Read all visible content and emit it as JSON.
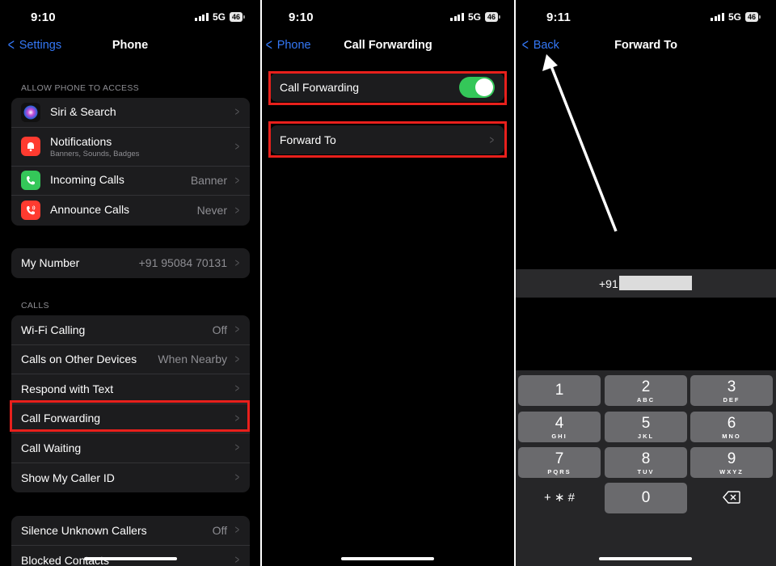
{
  "status": {
    "p1_time": "9:10",
    "p2_time": "9:10",
    "p3_time": "9:11",
    "network": "5G",
    "battery": "46"
  },
  "p1": {
    "back_label": "Settings",
    "title": "Phone",
    "section_access": "ALLOW PHONE TO ACCESS",
    "siri": "Siri & Search",
    "notifications": "Notifications",
    "notifications_sub": "Banners, Sounds, Badges",
    "incoming": "Incoming Calls",
    "incoming_value": "Banner",
    "announce": "Announce Calls",
    "announce_value": "Never",
    "my_number": "My Number",
    "my_number_value": "+91 95084 70131",
    "section_calls": "CALLS",
    "wifi": "Wi-Fi Calling",
    "wifi_value": "Off",
    "other_devices": "Calls on Other Devices",
    "other_devices_value": "When Nearby",
    "respond": "Respond with Text",
    "forwarding": "Call Forwarding",
    "waiting": "Call Waiting",
    "caller_id": "Show My Caller ID",
    "silence": "Silence Unknown Callers",
    "silence_value": "Off",
    "blocked": "Blocked Contacts"
  },
  "p2": {
    "back_label": "Phone",
    "title": "Call Forwarding",
    "toggle_label": "Call Forwarding",
    "toggle_on": true,
    "forward_to": "Forward To"
  },
  "p3": {
    "back_label": "Back",
    "title": "Forward To",
    "number_prefix": "+91",
    "keys": [
      {
        "d": "1",
        "l": ""
      },
      {
        "d": "2",
        "l": "ABC"
      },
      {
        "d": "3",
        "l": "DEF"
      },
      {
        "d": "4",
        "l": "GHI"
      },
      {
        "d": "5",
        "l": "JKL"
      },
      {
        "d": "6",
        "l": "MNO"
      },
      {
        "d": "7",
        "l": "PQRS"
      },
      {
        "d": "8",
        "l": "TUV"
      },
      {
        "d": "9",
        "l": "WXYZ"
      },
      {
        "d": "+ ∗ #",
        "l": ""
      },
      {
        "d": "0",
        "l": ""
      }
    ]
  },
  "colors": {
    "accent": "#3478f6",
    "highlight": "#e8201c",
    "toggle_on": "#34c759",
    "siri": "#2b2b6e",
    "notifications": "#ff3b30",
    "incoming": "#34c759",
    "announce": "#ff3b30"
  }
}
